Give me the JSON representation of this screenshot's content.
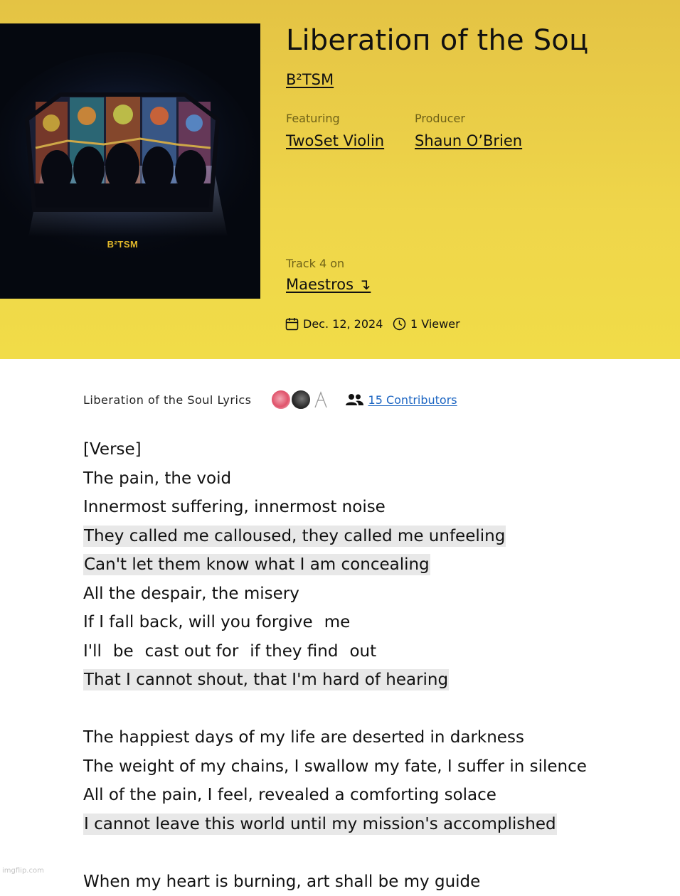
{
  "header": {
    "cover": {
      "logo_text": "B²TSM"
    },
    "title": "Liberatioп of the Soц",
    "artist": "B²TSM",
    "featuring": {
      "label": "Featuring",
      "value": "TwoSet Violin"
    },
    "producer": {
      "label": "Producer",
      "value": "Shaun O’Brien"
    },
    "track_label": "Track 4 on",
    "album": "Maestros ↴",
    "date": "Dec. 12, 2024",
    "viewers": "1 Viewer"
  },
  "lyrics_header": {
    "title": "Liberation of the Soul Lyrics",
    "contributors": "15 Contributors"
  },
  "lyrics": {
    "section": "[Verse]",
    "verse1": [
      "The pain, the void",
      "Innermost suffering, innermost noise",
      "They called me calloused, they called me unfeeling",
      "Can't let them know what I am concealing",
      "All the despair, the misery"
    ],
    "line_forgive": [
      "If I fall back, will you forgive",
      "me"
    ],
    "line_cast": [
      "I'll",
      "be",
      "cast out for",
      "if they find",
      "out"
    ],
    "line_shout": "That I cannot shout, that I'm hard of hearing",
    "verse2": [
      "The happiest days of my life are deserted in darkness",
      "The weight of my chains, I swallow my fate, I suffer in silence",
      "All of the pain, I feel, revealed a comforting solace",
      "I cannot leave this world until my mission's accomplished"
    ],
    "cut_line": "When my heart is burning, art shall be my guide"
  },
  "watermark": "imgflip.com",
  "colors": {
    "hero": "#efd64a",
    "link": "#1c65c2",
    "highlight": "#e8e8e8",
    "logo": "#e2b82a"
  }
}
